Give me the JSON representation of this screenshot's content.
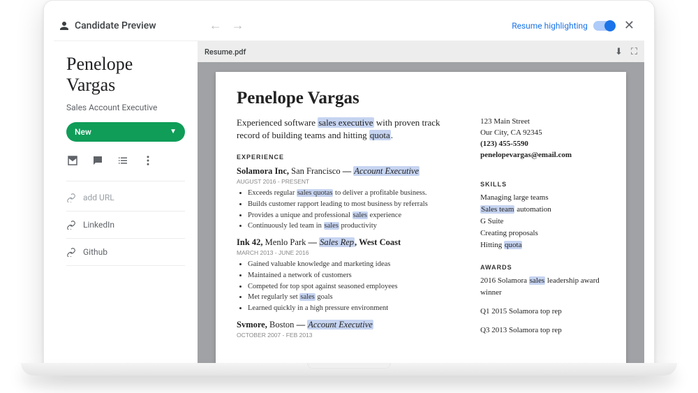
{
  "header": {
    "title": "Candidate Preview",
    "highlight_label": "Resume highlighting",
    "highlight_on": true
  },
  "candidate": {
    "name": "Penelope Vargas",
    "title": "Sales Account Executive",
    "status": "New",
    "links": {
      "add": "add URL",
      "linkedin": "LinkedIn",
      "github": "Github"
    }
  },
  "viewer": {
    "filename": "Resume.pdf"
  },
  "resume": {
    "name": "Penelope Vargas",
    "summary_parts": [
      "Experienced software ",
      "sales executive",
      " with proven track record of building teams and hitting ",
      "quota",
      "."
    ],
    "contact": {
      "street": "123 Main Street",
      "city": "Our City, CA 92345",
      "phone": "(123) 455-5590",
      "email": "penelopevargas@email.com"
    },
    "sections": {
      "experience": "EXPERIENCE",
      "skills": "SKILLS",
      "awards": "AWARDS"
    },
    "jobs": [
      {
        "company": "Solamora Inc,",
        "location": "San Francisco",
        "role": "Account Executive",
        "role_hl": true,
        "dates": "AUGUST 2016 - PRESENT",
        "bullets": [
          [
            "Exceeds regular ",
            "sales quotas",
            " to deliver a profitable business."
          ],
          [
            "Builds customer rapport leading to most business by referrals"
          ],
          [
            "Provides a unique and professional ",
            "sales",
            " experience"
          ],
          [
            "Continuously led team in ",
            "sales",
            " productivity"
          ]
        ]
      },
      {
        "company": "Ink 42,",
        "location": "Menlo Park",
        "role": "Sales Rep",
        "role_hl": true,
        "suffix": ", West Coast",
        "dates": "MARCH 2013 - JUNE 2016",
        "bullets": [
          [
            "Gained valuable knowledge and marketing ideas"
          ],
          [
            "Maintained a network of customers"
          ],
          [
            "Competed for top spot against seasoned employees"
          ],
          [
            "Met regularly set ",
            "sales",
            " goals"
          ],
          [
            "Learned quickly in a high pressure environment"
          ]
        ]
      },
      {
        "company": "Svmore,",
        "location": "Boston",
        "role": "Account Executive",
        "role_hl": true,
        "dates": "OCTOBER 2007 - FEB 2013",
        "bullets": []
      }
    ],
    "skills": [
      [
        "Managing large teams"
      ],
      [
        "Sales team",
        " automation"
      ],
      [
        "G Suite"
      ],
      [
        "Creating proposals"
      ],
      [
        "Hitting ",
        "quota"
      ]
    ],
    "awards": [
      [
        "2016 Solamora ",
        "sales",
        " leadership award winner"
      ],
      [
        "Q1  2015 Solamora top rep"
      ],
      [
        "Q3 2013 Solamora top rep"
      ]
    ]
  }
}
